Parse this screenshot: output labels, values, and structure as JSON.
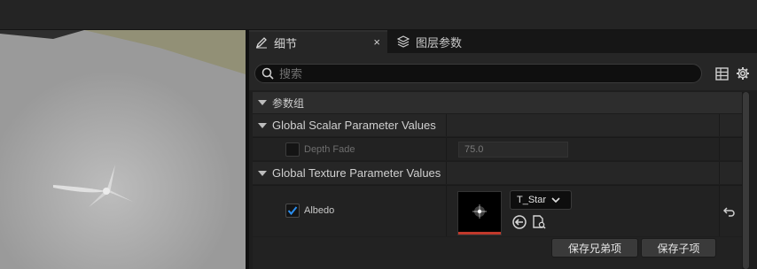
{
  "tabs": {
    "details_label": "细节",
    "close_symbol": "×",
    "layer_params_label": "图层参数"
  },
  "search": {
    "placeholder": "搜索"
  },
  "categories": {
    "param_group_label": "参数组",
    "global_scalar_label": "Global Scalar Parameter Values",
    "global_texture_label": "Global Texture Parameter Values"
  },
  "scalar_params": {
    "depth_fade_label": "Depth Fade",
    "depth_fade_value": "75.0",
    "depth_fade_checked": false
  },
  "texture_params": {
    "albedo_label": "Albedo",
    "albedo_checked": true,
    "albedo_asset": "T_Star"
  },
  "buttons": {
    "save_sibling": "保存兄弟项",
    "save_child": "保存子项"
  },
  "colors": {
    "accent_check": "#1e88e5",
    "thumb_bar": "#c0392b"
  }
}
